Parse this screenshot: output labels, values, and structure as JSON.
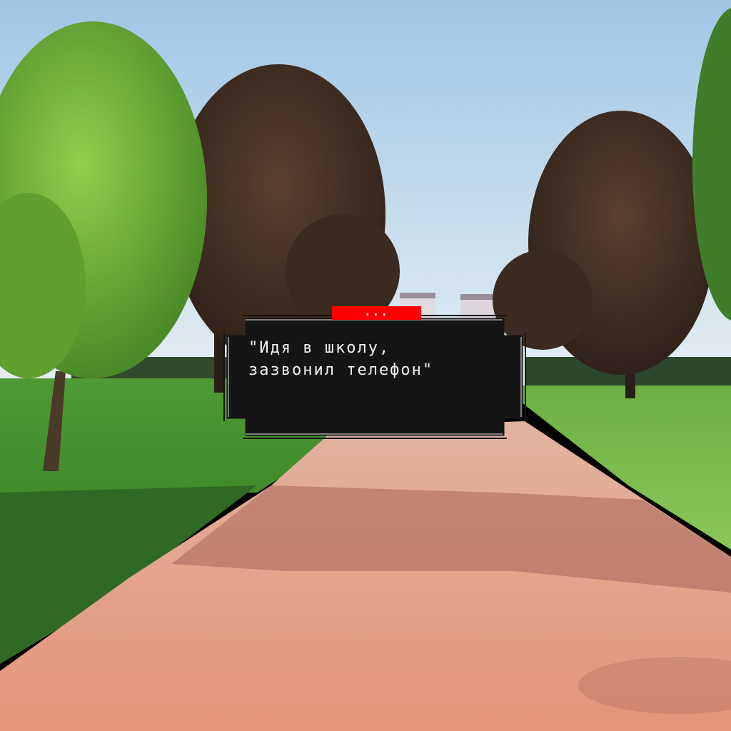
{
  "scene": {
    "description_colors": {
      "sky_top": "#a9cbe6",
      "sky_bottom": "#e4eef4",
      "grass": "#6fb640",
      "path": "#e39a7e",
      "dialog_bg": "#151515",
      "speaker_tag_bg": "#ff0000"
    }
  },
  "dialog": {
    "speaker": "...",
    "line1": "\"Идя в школу,",
    "line2": " зазвонил телефон\""
  }
}
